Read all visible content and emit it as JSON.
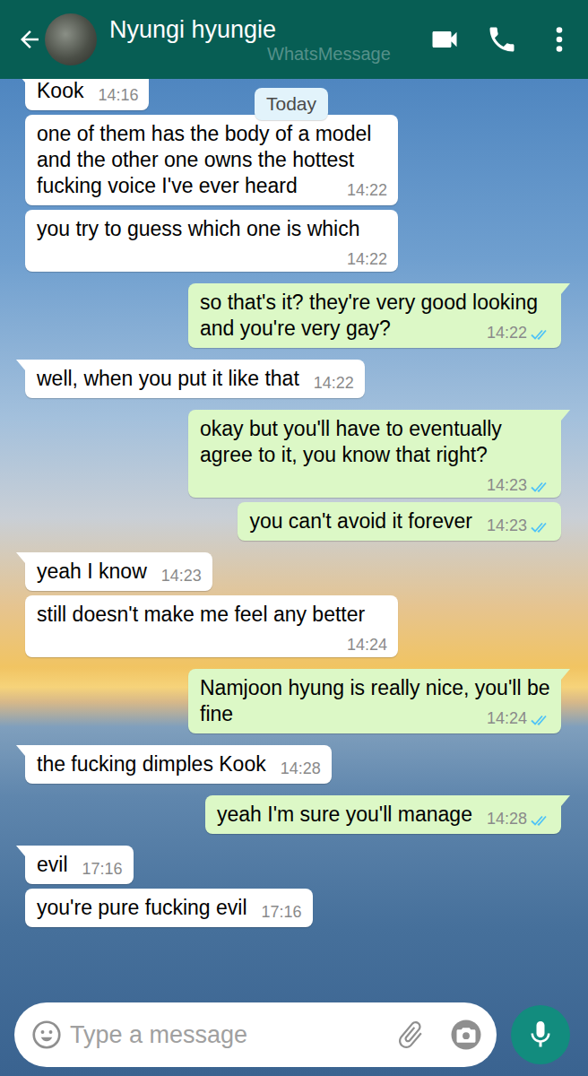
{
  "header": {
    "title": "Nyungi hyungie",
    "watermark": "WhatsMessage"
  },
  "date_chip": "Today",
  "messages": [
    {
      "kind": "incoming",
      "text": "Kook",
      "time": "14:16"
    },
    {
      "kind": "incoming",
      "text": "one of them has the body of a model and the other one owns the hottest fucking voice I've ever heard",
      "time": "14:22"
    },
    {
      "kind": "incoming",
      "text": "you try to guess which one is which",
      "time": "14:22"
    },
    {
      "kind": "outgoing",
      "text": "so that's it? they're very good looking and you're very gay?",
      "time": "14:22",
      "read": true
    },
    {
      "kind": "incoming",
      "text": "well, when you put it like that",
      "time": "14:22"
    },
    {
      "kind": "outgoing",
      "text": "okay but you'll have to eventually agree to it, you know that right?",
      "time": "14:23",
      "read": true
    },
    {
      "kind": "outgoing",
      "text": "you can't avoid it forever",
      "time": "14:23",
      "read": true
    },
    {
      "kind": "incoming",
      "text": "yeah I know",
      "time": "14:23"
    },
    {
      "kind": "incoming",
      "text": "still doesn't make me feel any better",
      "time": "14:24"
    },
    {
      "kind": "outgoing",
      "text": "Namjoon hyung is really nice, you'll be fine",
      "time": "14:24",
      "read": true
    },
    {
      "kind": "incoming",
      "text": "the fucking dimples Kook",
      "time": "14:28"
    },
    {
      "kind": "outgoing",
      "text": "yeah I'm sure you'll manage",
      "time": "14:28",
      "read": true
    },
    {
      "kind": "incoming",
      "text": "evil",
      "time": "17:16"
    },
    {
      "kind": "incoming",
      "text": "you're pure fucking evil",
      "time": "17:16"
    }
  ],
  "composer": {
    "placeholder": "Type a message"
  }
}
